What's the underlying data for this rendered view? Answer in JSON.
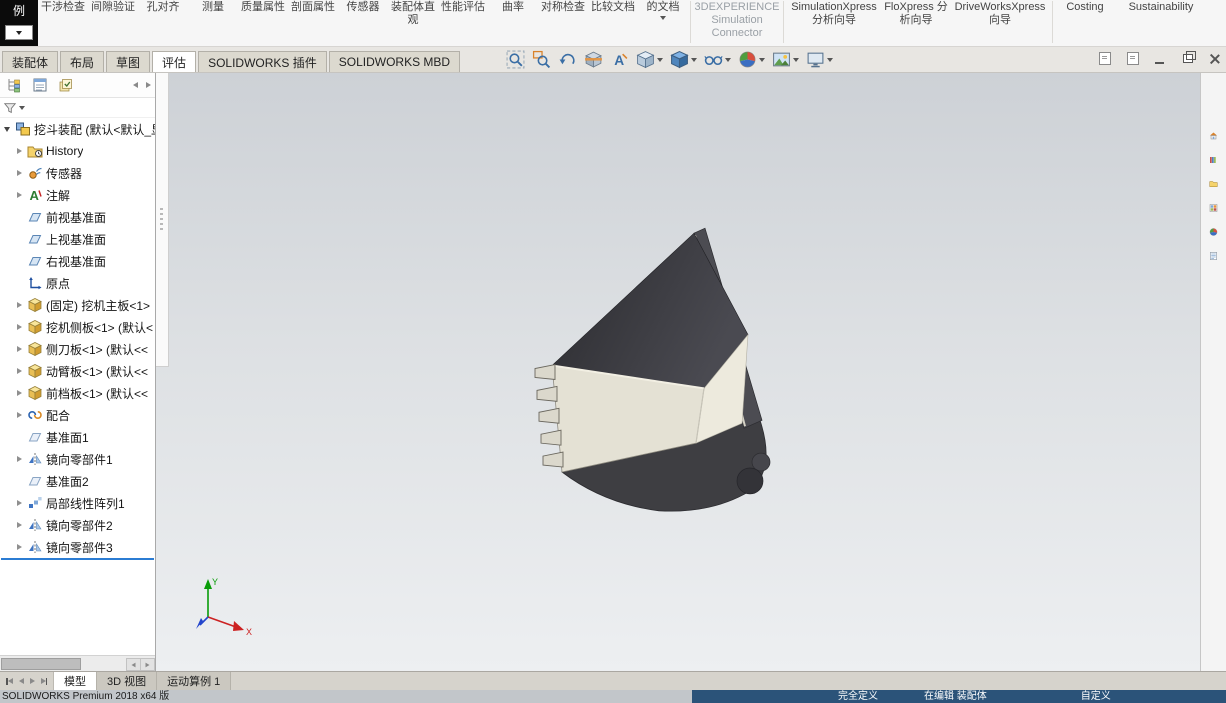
{
  "app": {
    "status_left": "SOLIDWORKS Premium 2018 x64 版"
  },
  "ribbon": {
    "corner_label": "例",
    "items": [
      "干涉检查",
      "间隙验证",
      "孔对齐",
      "测量",
      "质量属性",
      "剖面属性",
      "传感器",
      "装配体直观",
      "性能评估",
      "曲率",
      "对称检查",
      "比较文档",
      "的文档",
      "3DEXPERIENCE Simulation Connector",
      "SimulationXpress 分析向导",
      "FloXpress 分析向导",
      "DriveWorksXpress 向导",
      "Costing",
      "Sustainability"
    ]
  },
  "command_tabs": {
    "active": "评估",
    "items": [
      "装配体",
      "布局",
      "草图",
      "评估",
      "SOLIDWORKS 插件",
      "SOLIDWORKS MBD"
    ]
  },
  "viewport_toolbar": {
    "icons": [
      "zoom-to-fit",
      "zoom-to-area",
      "previous-view",
      "section-view",
      "dynamic-annotation-views",
      "view-orientation",
      "display-style",
      "hide-show-items",
      "edit-appearance",
      "apply-scene",
      "view-settings"
    ]
  },
  "feature_tree": {
    "items": [
      {
        "label": "挖斗装配 (默认<默认_显",
        "icon": "assembly",
        "expanded": true
      },
      {
        "label": "History",
        "icon": "history-folder",
        "expandable": true
      },
      {
        "label": "传感器",
        "icon": "sensor-folder",
        "expandable": true
      },
      {
        "label": "注解",
        "icon": "annotations-folder",
        "expandable": true
      },
      {
        "label": "前视基准面",
        "icon": "plane"
      },
      {
        "label": "上视基准面",
        "icon": "plane"
      },
      {
        "label": "右视基准面",
        "icon": "plane"
      },
      {
        "label": "原点",
        "icon": "origin"
      },
      {
        "label": "(固定) 挖机主板<1>",
        "icon": "part",
        "expandable": true
      },
      {
        "label": "挖机侧板<1> (默认<",
        "icon": "part",
        "expandable": true
      },
      {
        "label": "侧刀板<1> (默认<<",
        "icon": "part",
        "expandable": true
      },
      {
        "label": "动臂板<1> (默认<<",
        "icon": "part",
        "expandable": true
      },
      {
        "label": "前档板<1> (默认<<",
        "icon": "part",
        "expandable": true
      },
      {
        "label": "配合",
        "icon": "mates",
        "expandable": true
      },
      {
        "label": "基准面1",
        "icon": "plane-feature"
      },
      {
        "label": "镜向零部件1",
        "icon": "mirror-component",
        "expandable": true
      },
      {
        "label": "基准面2",
        "icon": "plane-feature"
      },
      {
        "label": "局部线性阵列1",
        "icon": "linear-pattern",
        "expandable": true
      },
      {
        "label": "镜向零部件2",
        "icon": "mirror-component",
        "expandable": true
      },
      {
        "label": "镜向零部件3",
        "icon": "mirror-component",
        "expandable": true
      }
    ]
  },
  "task_pane": {
    "icons": [
      "solidworks-resources",
      "design-library",
      "file-explorer",
      "view-palette",
      "appearances-scenes",
      "custom-properties"
    ]
  },
  "document_tabs": {
    "active": "模型",
    "items": [
      "模型",
      "3D 视图",
      "运动算例 1"
    ]
  },
  "status_bar": {
    "define_state": "完全定义",
    "editing": "在编辑 装配体",
    "customize": "自定义"
  },
  "model": {
    "name": "挖斗装配",
    "colors": {
      "shell": "#3e3e42",
      "floor_plate": "#e4e1d4",
      "opening_dark": "#2e2e33"
    }
  }
}
